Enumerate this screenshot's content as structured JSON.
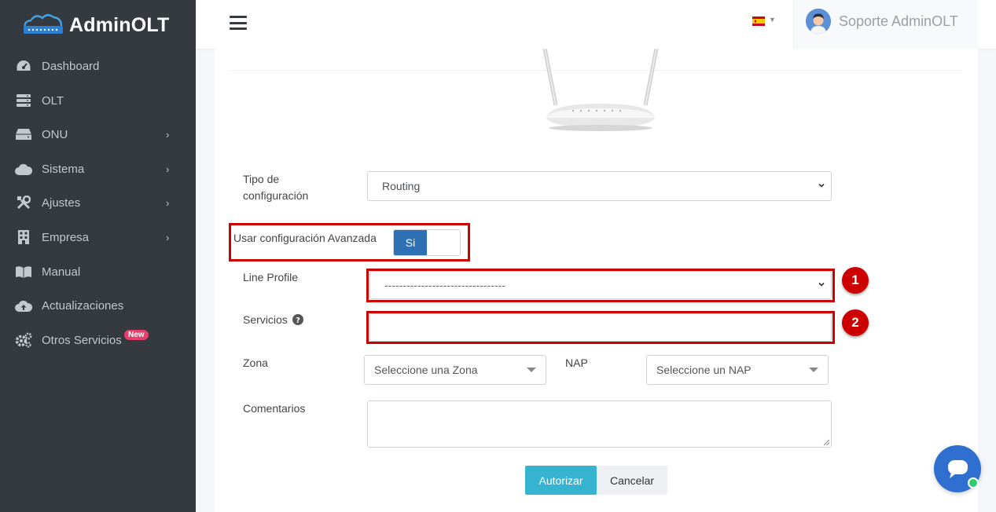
{
  "brand": {
    "name": "AdminOLT"
  },
  "sidebar": {
    "items": [
      {
        "label": "Dashboard",
        "icon": "dashboard-icon",
        "has_children": false
      },
      {
        "label": "OLT",
        "icon": "server-icon",
        "has_children": false
      },
      {
        "label": "ONU",
        "icon": "hdd-icon",
        "has_children": true
      },
      {
        "label": "Sistema",
        "icon": "cloud-icon",
        "has_children": true
      },
      {
        "label": "Ajustes",
        "icon": "tools-icon",
        "has_children": true
      },
      {
        "label": "Empresa",
        "icon": "building-icon",
        "has_children": true
      },
      {
        "label": "Manual",
        "icon": "book-icon",
        "has_children": false
      },
      {
        "label": "Actualizaciones",
        "icon": "cloud-upload-icon",
        "has_children": false
      },
      {
        "label": "Otros Servicios",
        "icon": "cogs-icon",
        "has_children": false,
        "badge": "New"
      }
    ],
    "chevron": "›"
  },
  "topbar": {
    "language": "es",
    "user_name": "Soporte AdminOLT"
  },
  "form": {
    "config_type": {
      "label_line1": "Tipo de",
      "label_line2": "configuración",
      "value": "Routing"
    },
    "advanced": {
      "label": "Usar configuración Avanzada",
      "toggle_label": "Si",
      "enabled": true
    },
    "line_profile": {
      "label": "Line Profile",
      "value": "---------------------------------"
    },
    "servicios": {
      "label": "Servicios",
      "value": ""
    },
    "zona": {
      "label": "Zona",
      "placeholder": "Seleccione una Zona"
    },
    "nap": {
      "label": "NAP",
      "placeholder": "Seleccione un NAP"
    },
    "comentarios": {
      "label": "Comentarios",
      "value": ""
    },
    "buttons": {
      "authorize": "Autorizar",
      "cancel": "Cancelar"
    }
  },
  "annotations": {
    "marker_1": "1",
    "marker_2": "2"
  },
  "colors": {
    "sidebar": "#343a40",
    "accent_blue": "#2f6fb3",
    "primary_button": "#36b3d1",
    "annotation_red": "#cc0000",
    "badge": "#e83e6c"
  }
}
